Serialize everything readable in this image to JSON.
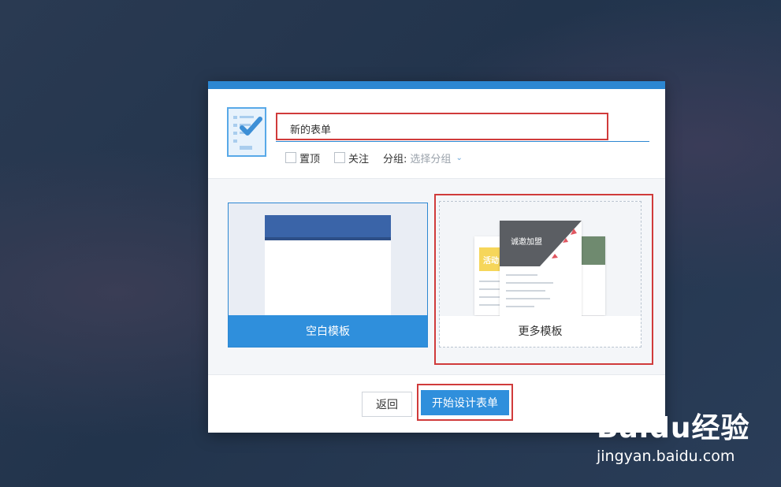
{
  "dialog": {
    "form_name": {
      "value": "新的表单"
    },
    "options": {
      "pin_label": "置顶",
      "follow_label": "关注",
      "group_label": "分组:",
      "group_select_placeholder": "选择分组"
    },
    "templates": {
      "blank": {
        "label": "空白模板"
      },
      "more": {
        "label": "更多模板",
        "preview_texts": {
          "banner": "诚邀加盟",
          "badge": "活动"
        }
      }
    },
    "footer": {
      "back_label": "返回",
      "start_label": "开始设计表单"
    }
  },
  "watermark": {
    "logo_text": "Baidu经验",
    "url": "jingyan.baidu.com"
  },
  "colors": {
    "accent": "#2f8fdc",
    "highlight_red": "#d03b3b",
    "topbar": "#2c87d2"
  }
}
